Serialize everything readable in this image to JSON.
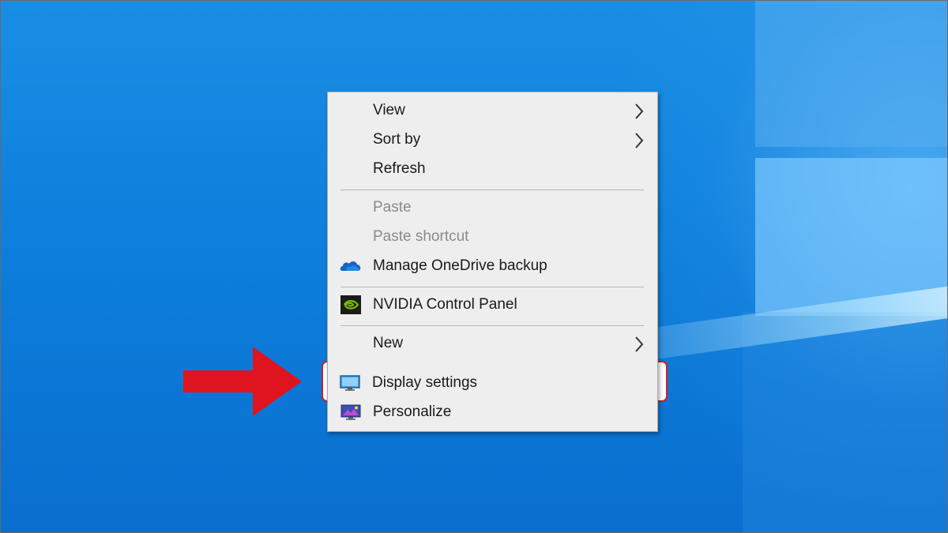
{
  "desktop": {
    "background_color": "#0d7fdc"
  },
  "context_menu": {
    "items": [
      {
        "label": "View",
        "has_submenu": true,
        "enabled": true
      },
      {
        "label": "Sort by",
        "has_submenu": true,
        "enabled": true
      },
      {
        "label": "Refresh",
        "has_submenu": false,
        "enabled": true
      },
      {
        "label": "Paste",
        "has_submenu": false,
        "enabled": false
      },
      {
        "label": "Paste shortcut",
        "has_submenu": false,
        "enabled": false
      },
      {
        "label": "Manage OneDrive backup",
        "icon": "onedrive-cloud-icon",
        "has_submenu": false,
        "enabled": true
      },
      {
        "label": "NVIDIA Control Panel",
        "icon": "nvidia-icon",
        "has_submenu": false,
        "enabled": true
      },
      {
        "label": "New",
        "has_submenu": true,
        "enabled": true
      },
      {
        "label": "Display settings",
        "icon": "display-monitor-icon",
        "has_submenu": false,
        "enabled": true,
        "highlighted": true
      },
      {
        "label": "Personalize",
        "icon": "personalize-icon",
        "has_submenu": false,
        "enabled": true
      }
    ]
  },
  "annotation": {
    "arrow_color": "#e0141e",
    "highlight_color": "#d21c2c",
    "pointer_icon": "red-arrow-icon"
  }
}
